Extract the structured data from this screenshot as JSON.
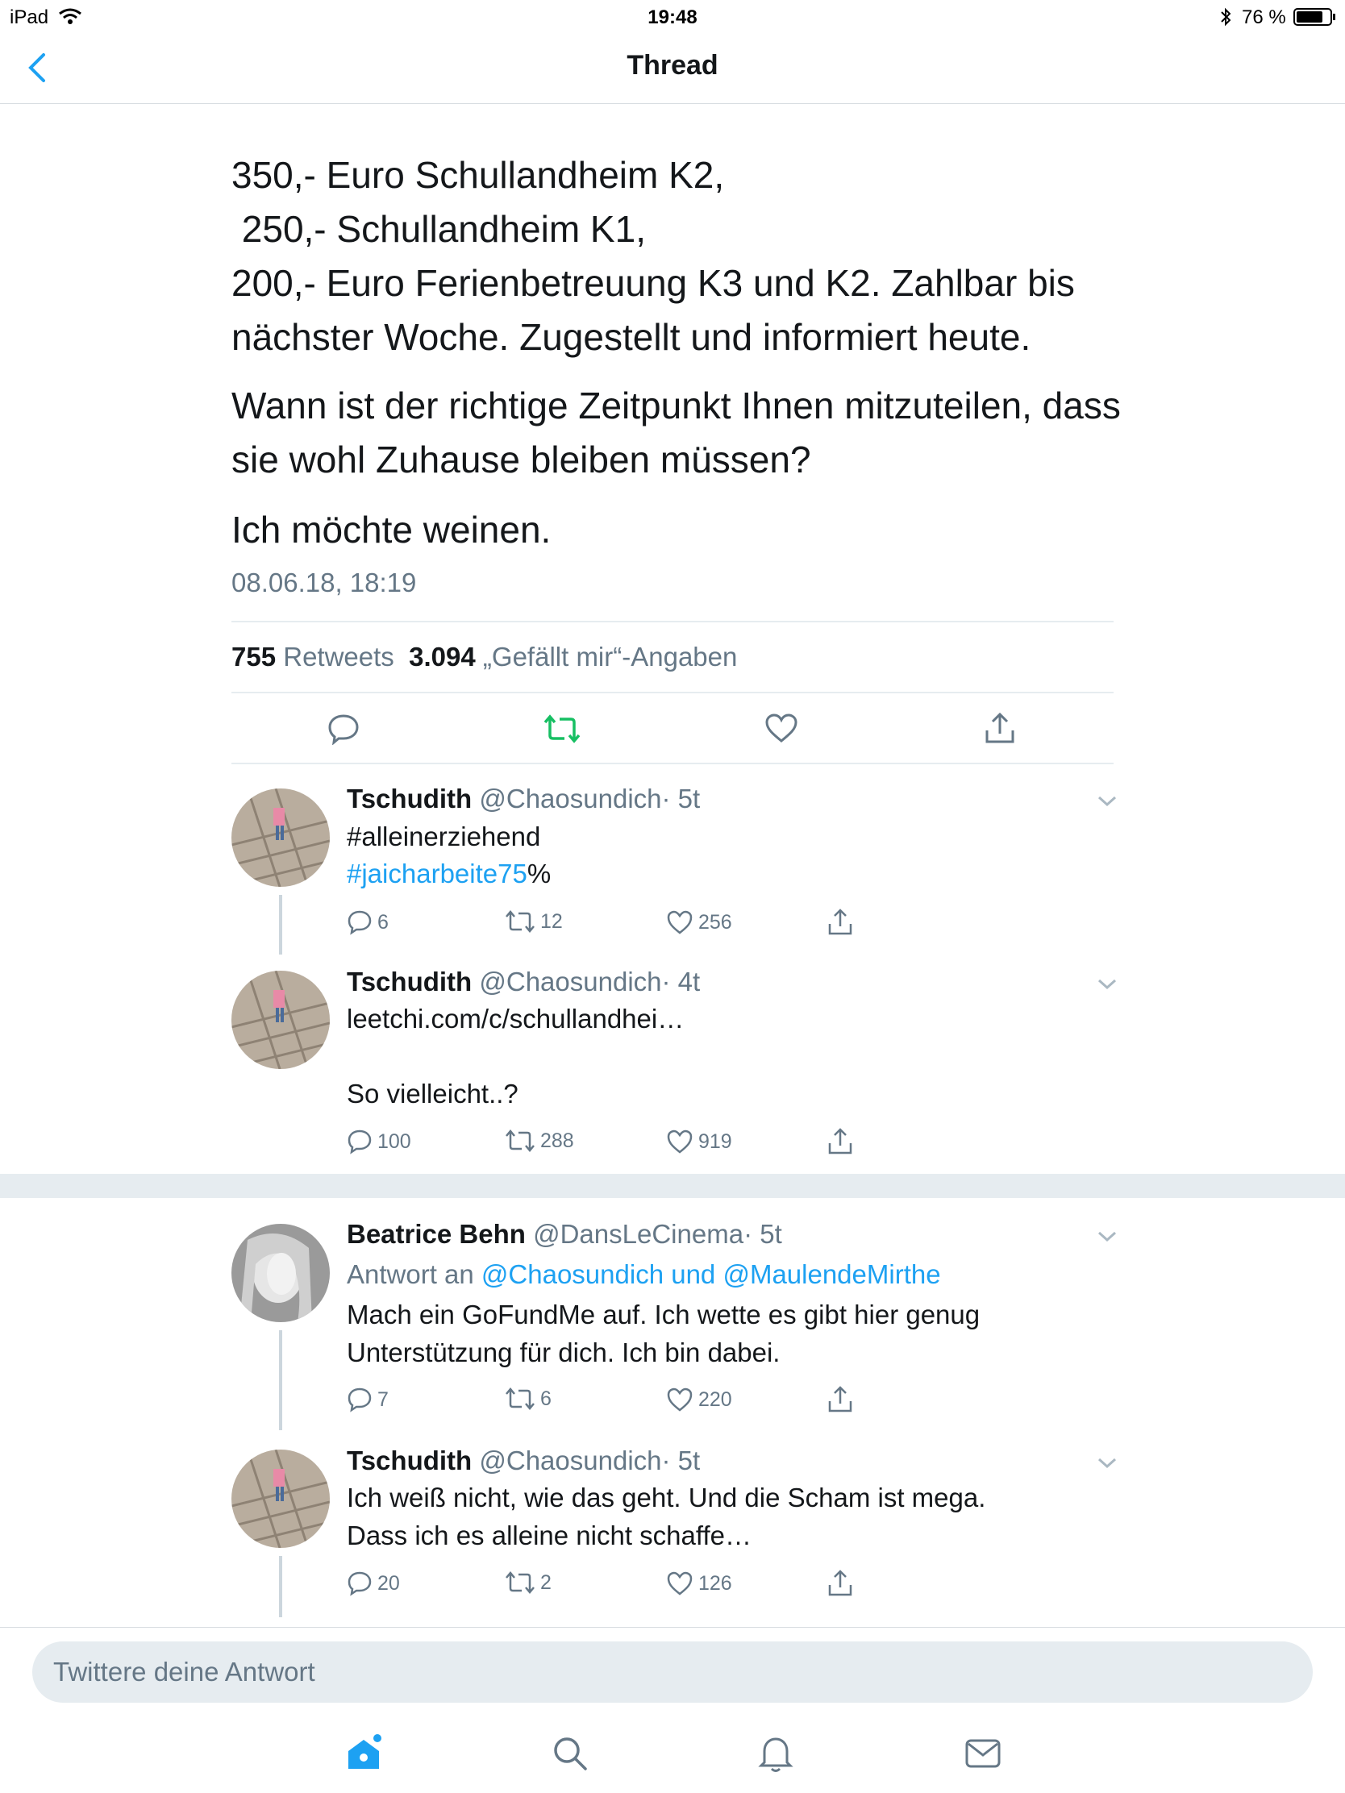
{
  "status_bar": {
    "device": "iPad",
    "time": "19:48",
    "battery": "76 %"
  },
  "nav": {
    "title": "Thread"
  },
  "main_tweet": {
    "lines": [
      "350,- Euro Schullandheim K2,",
      " 250,- Schullandheim K1,",
      "200,- Euro Ferienbetreuung K3 und K2. Zahlbar bis",
      "nächster Woche. Zugestellt und informiert heute.",
      "Wann ist der richtige Zeitpunkt Ihnen mitzuteilen, dass",
      "sie wohl Zuhause bleiben müssen?",
      "Ich möchte weinen."
    ],
    "timestamp": "08.06.18, 18:19",
    "retweets_count": "755",
    "retweets_label": "Retweets",
    "likes_count": "3.094",
    "likes_label": "„Gefällt mir“-Angaben"
  },
  "replies": [
    {
      "name": "Tschudith",
      "handle": "@Chaosundich",
      "time": "· 5t",
      "hashtag1": "#alleinerziehend",
      "hashtag2": "#jaicharbeite75",
      "suffix": "%",
      "replies": "6",
      "retweets": "12",
      "likes": "256"
    },
    {
      "name": "Tschudith",
      "handle": "@Chaosundich",
      "time": "· 4t",
      "link": "leetchi.com/c/schullandhei…",
      "text": "So vielleicht..?",
      "replies": "100",
      "retweets": "288",
      "likes": "919"
    },
    {
      "name": "Beatrice Behn",
      "handle": "@DansLeCinema",
      "time": "· 5t",
      "reply_to_prefix": "Antwort an",
      "reply_to_users": "@Chaosundich und @MaulendeMirthe",
      "text_line1": "Mach ein GoFundMe auf. Ich wette es gibt hier genug",
      "text_line2": "Unterstützung für dich. Ich bin dabei.",
      "replies": "7",
      "retweets": "6",
      "likes": "220"
    },
    {
      "name": "Tschudith",
      "handle": "@Chaosundich",
      "time": "· 5t",
      "text_line1": "Ich weiß nicht, wie das geht. Und die Scham ist mega.",
      "text_line2": "Dass ich es alleine nicht schaffe…",
      "replies": "20",
      "retweets": "2",
      "likes": "126"
    }
  ],
  "composer": {
    "placeholder": "Twittere deine Antwort"
  },
  "tab_bar": {
    "icons": [
      "home-icon",
      "search-icon",
      "notifications-icon",
      "messages-icon"
    ]
  },
  "colors": {
    "accent": "#1da1f2",
    "retweet_green": "#17bf63",
    "text": "#14171a",
    "secondary": "#657786"
  }
}
